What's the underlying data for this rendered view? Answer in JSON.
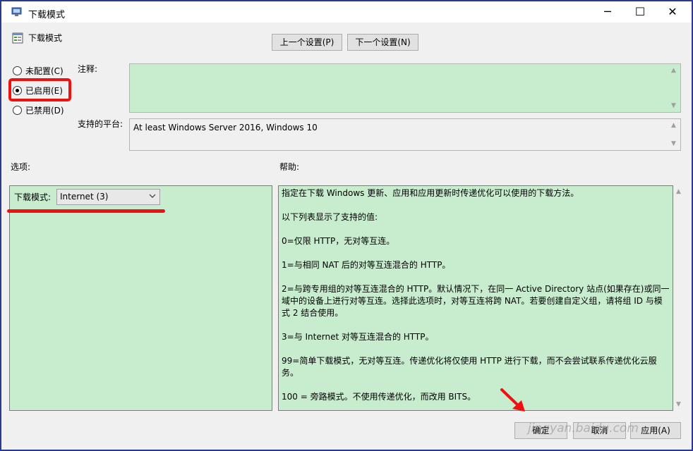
{
  "window": {
    "title": "下载模式",
    "minimize_glyph": "─",
    "maximize_glyph": "☐",
    "close_glyph": "✕"
  },
  "header": {
    "title": "下载模式"
  },
  "nav": {
    "prev_label": "上一个设置(P)",
    "next_label": "下一个设置(N)"
  },
  "state": {
    "options": [
      {
        "label": "未配置(C)",
        "selected": false
      },
      {
        "label": "已启用(E)",
        "selected": true
      },
      {
        "label": "已禁用(D)",
        "selected": false
      }
    ]
  },
  "comment": {
    "label": "注释:",
    "value": ""
  },
  "platform": {
    "label": "支持的平台:",
    "value": "At least Windows Server 2016, Windows 10"
  },
  "options_panel": {
    "heading": "选项:",
    "field_label": "下载模式:",
    "selected_value": "Internet (3)"
  },
  "help_panel": {
    "heading": "帮助:",
    "paragraphs": [
      "指定在下载 Windows 更新、应用和应用更新时传递优化可以使用的下载方法。",
      "以下列表显示了支持的值:",
      "0=仅限 HTTP，无对等互连。",
      "1=与相同 NAT 后的对等互连混合的 HTTP。",
      "2=与跨专用组的对等互连混合的 HTTP。默认情况下，在同一 Active Directory 站点(如果存在)或同一域中的设备上进行对等互连。选择此选项时，对等互连将跨 NAT。若要创建自定义组，请将组 ID 与模式 2 结合使用。",
      "3=与 Internet 对等互连混合的 HTTP。",
      "99=简单下载模式，无对等互连。传递优化将仅使用 HTTP 进行下载，而不会尝试联系传递优化云服务。",
      "100 = 旁路模式。不使用传递优化，而改用 BITS。"
    ]
  },
  "footer": {
    "ok_label": "确定",
    "cancel_label": "取消",
    "apply_label": "应用(A)"
  },
  "watermark": "jingyan.baidu.com",
  "colors": {
    "panel_green": "#c8ecce",
    "highlight_red": "#ee1111",
    "window_border": "#2b3a8c"
  },
  "icons": [
    "app-icon",
    "policy-setting-icon",
    "chevron-down-icon",
    "scroll-up-icon",
    "scroll-down-icon",
    "red-arrow-annotation"
  ]
}
